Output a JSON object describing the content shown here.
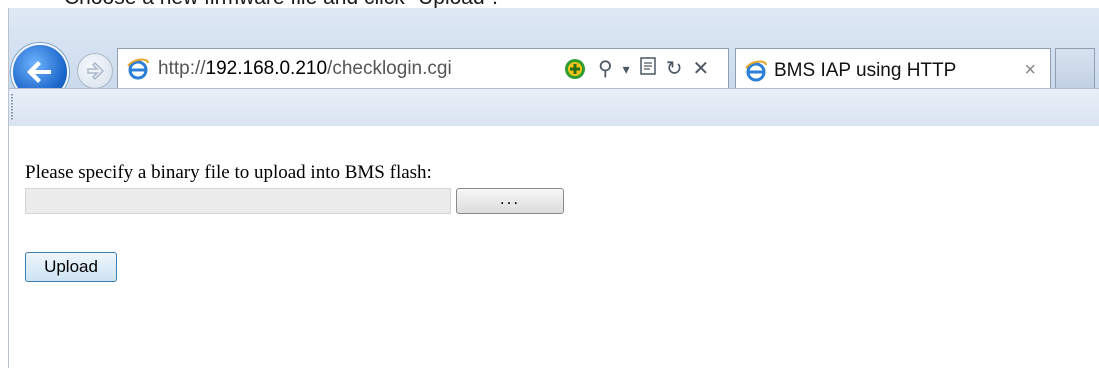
{
  "caption": "Choose a new firmware file and click \"Upload\".",
  "browser": {
    "url_prefix": "http://",
    "url_host": "192.168.0.210",
    "url_path": "/checklogin.cgi",
    "tab_title": "BMS IAP using HTTP",
    "tab_close": "×",
    "search_glyph": "⚲",
    "dropdown_glyph": "▾",
    "refresh_glyph": "↻",
    "stop_glyph": "✕"
  },
  "page": {
    "prompt": "Please specify a binary file to upload into BMS flash:",
    "file_value": "",
    "browse_label": "...",
    "upload_label": "Upload"
  },
  "colors": {
    "accent_blue": "#1a66c9",
    "chrome_bg": "#cddcee"
  }
}
